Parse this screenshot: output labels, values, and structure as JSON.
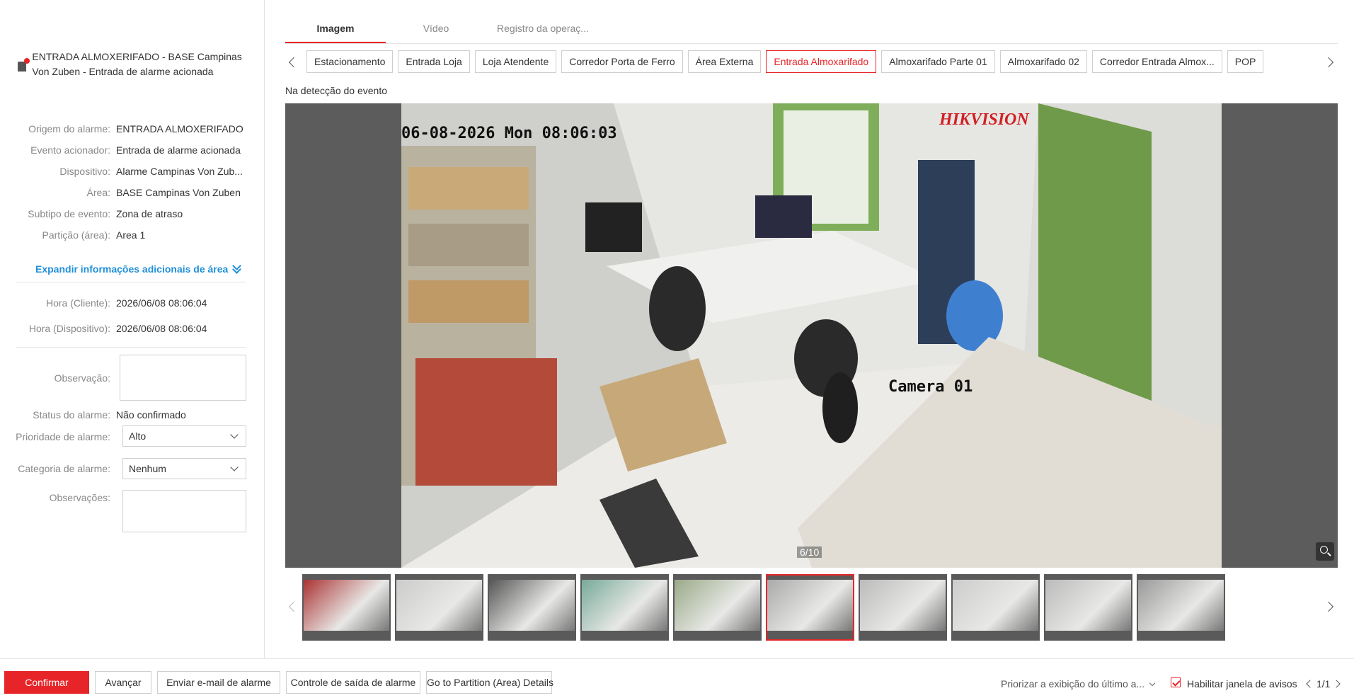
{
  "alarm": {
    "title": "ENTRADA ALMOXERIFADO - BASE Campinas Von Zuben - Entrada de alarme acionada"
  },
  "details": [
    {
      "label": "Origem do alarme:",
      "value": "ENTRADA ALMOXERIFADO"
    },
    {
      "label": "Evento acionador:",
      "value": "Entrada de alarme acionada"
    },
    {
      "label": "Dispositivo:",
      "value": "Alarme Campinas Von Zub..."
    },
    {
      "label": "Área:",
      "value": "BASE Campinas Von Zuben"
    },
    {
      "label": "Subtipo de evento:",
      "value": "Zona de atraso"
    },
    {
      "label": "Partição (área):",
      "value": "Area 1"
    }
  ],
  "expand_label": "Expandir informações adicionais de área",
  "times": [
    {
      "label": "Hora (Cliente):",
      "value": "2026/06/08 08:06:04"
    },
    {
      "label": "Hora (Dispositivo):",
      "value": "2026/06/08 08:06:04"
    }
  ],
  "form": {
    "observacao_label": "Observação:",
    "status_label": "Status do alarme:",
    "status_value": "Não confirmado",
    "prioridade_label": "Prioridade de alarme:",
    "prioridade_value": "Alto",
    "categoria_label": "Categoria de alarme:",
    "categoria_value": "Nenhum",
    "observacoes_label": "Observações:"
  },
  "tabs": [
    "Imagem",
    "Vídeo",
    "Registro da operaç..."
  ],
  "cameras": [
    "Estacionamento",
    "Entrada Loja",
    "Loja Atendente",
    "Corredor Porta de Ferro",
    "Área Externa",
    "Entrada Almoxarifado",
    "Almoxarifado Parte 01",
    "Almoxarifado 02",
    "Corredor Entrada Almox...",
    "POP"
  ],
  "active_camera": "Entrada Almoxarifado",
  "subhead": "Na detecção do evento",
  "image": {
    "timestamp": "06-08-2026 Mon 08:06:03",
    "brand": "HIKVISION",
    "camera_label": "Camera 01",
    "counter": "6/10"
  },
  "thumbnails_count": 10,
  "active_thumbnail": 6,
  "bottom": {
    "confirm": "Confirmar",
    "next": "Avançar",
    "email": "Enviar e-mail de alarme",
    "output": "Controle de saída de alarme",
    "partition": "Go to Partition (Area) Details",
    "priority_view": "Priorizar a exibição do último a...",
    "enable_popup": "Habilitar janela de avisos",
    "pager": "1/1"
  },
  "colors": {
    "accent": "#e72528",
    "link": "#1f8fd8"
  }
}
